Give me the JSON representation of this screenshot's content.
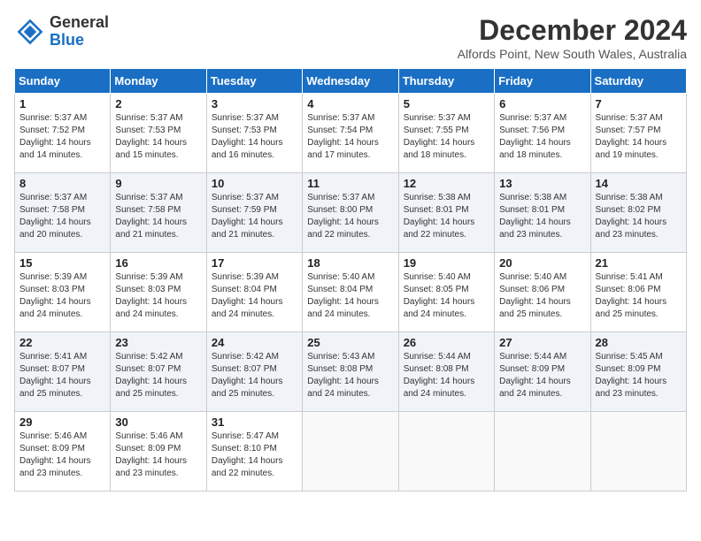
{
  "header": {
    "logo_line1": "General",
    "logo_line2": "Blue",
    "month_year": "December 2024",
    "location": "Alfords Point, New South Wales, Australia"
  },
  "weekdays": [
    "Sunday",
    "Monday",
    "Tuesday",
    "Wednesday",
    "Thursday",
    "Friday",
    "Saturday"
  ],
  "weeks": [
    [
      {
        "day": "1",
        "sunrise": "5:37 AM",
        "sunset": "7:52 PM",
        "daylight": "14 hours and 14 minutes."
      },
      {
        "day": "2",
        "sunrise": "5:37 AM",
        "sunset": "7:53 PM",
        "daylight": "14 hours and 15 minutes."
      },
      {
        "day": "3",
        "sunrise": "5:37 AM",
        "sunset": "7:53 PM",
        "daylight": "14 hours and 16 minutes."
      },
      {
        "day": "4",
        "sunrise": "5:37 AM",
        "sunset": "7:54 PM",
        "daylight": "14 hours and 17 minutes."
      },
      {
        "day": "5",
        "sunrise": "5:37 AM",
        "sunset": "7:55 PM",
        "daylight": "14 hours and 18 minutes."
      },
      {
        "day": "6",
        "sunrise": "5:37 AM",
        "sunset": "7:56 PM",
        "daylight": "14 hours and 18 minutes."
      },
      {
        "day": "7",
        "sunrise": "5:37 AM",
        "sunset": "7:57 PM",
        "daylight": "14 hours and 19 minutes."
      }
    ],
    [
      {
        "day": "8",
        "sunrise": "5:37 AM",
        "sunset": "7:58 PM",
        "daylight": "14 hours and 20 minutes."
      },
      {
        "day": "9",
        "sunrise": "5:37 AM",
        "sunset": "7:58 PM",
        "daylight": "14 hours and 21 minutes."
      },
      {
        "day": "10",
        "sunrise": "5:37 AM",
        "sunset": "7:59 PM",
        "daylight": "14 hours and 21 minutes."
      },
      {
        "day": "11",
        "sunrise": "5:37 AM",
        "sunset": "8:00 PM",
        "daylight": "14 hours and 22 minutes."
      },
      {
        "day": "12",
        "sunrise": "5:38 AM",
        "sunset": "8:01 PM",
        "daylight": "14 hours and 22 minutes."
      },
      {
        "day": "13",
        "sunrise": "5:38 AM",
        "sunset": "8:01 PM",
        "daylight": "14 hours and 23 minutes."
      },
      {
        "day": "14",
        "sunrise": "5:38 AM",
        "sunset": "8:02 PM",
        "daylight": "14 hours and 23 minutes."
      }
    ],
    [
      {
        "day": "15",
        "sunrise": "5:39 AM",
        "sunset": "8:03 PM",
        "daylight": "14 hours and 24 minutes."
      },
      {
        "day": "16",
        "sunrise": "5:39 AM",
        "sunset": "8:03 PM",
        "daylight": "14 hours and 24 minutes."
      },
      {
        "day": "17",
        "sunrise": "5:39 AM",
        "sunset": "8:04 PM",
        "daylight": "14 hours and 24 minutes."
      },
      {
        "day": "18",
        "sunrise": "5:40 AM",
        "sunset": "8:04 PM",
        "daylight": "14 hours and 24 minutes."
      },
      {
        "day": "19",
        "sunrise": "5:40 AM",
        "sunset": "8:05 PM",
        "daylight": "14 hours and 24 minutes."
      },
      {
        "day": "20",
        "sunrise": "5:40 AM",
        "sunset": "8:06 PM",
        "daylight": "14 hours and 25 minutes."
      },
      {
        "day": "21",
        "sunrise": "5:41 AM",
        "sunset": "8:06 PM",
        "daylight": "14 hours and 25 minutes."
      }
    ],
    [
      {
        "day": "22",
        "sunrise": "5:41 AM",
        "sunset": "8:07 PM",
        "daylight": "14 hours and 25 minutes."
      },
      {
        "day": "23",
        "sunrise": "5:42 AM",
        "sunset": "8:07 PM",
        "daylight": "14 hours and 25 minutes."
      },
      {
        "day": "24",
        "sunrise": "5:42 AM",
        "sunset": "8:07 PM",
        "daylight": "14 hours and 25 minutes."
      },
      {
        "day": "25",
        "sunrise": "5:43 AM",
        "sunset": "8:08 PM",
        "daylight": "14 hours and 24 minutes."
      },
      {
        "day": "26",
        "sunrise": "5:44 AM",
        "sunset": "8:08 PM",
        "daylight": "14 hours and 24 minutes."
      },
      {
        "day": "27",
        "sunrise": "5:44 AM",
        "sunset": "8:09 PM",
        "daylight": "14 hours and 24 minutes."
      },
      {
        "day": "28",
        "sunrise": "5:45 AM",
        "sunset": "8:09 PM",
        "daylight": "14 hours and 23 minutes."
      }
    ],
    [
      {
        "day": "29",
        "sunrise": "5:46 AM",
        "sunset": "8:09 PM",
        "daylight": "14 hours and 23 minutes."
      },
      {
        "day": "30",
        "sunrise": "5:46 AM",
        "sunset": "8:09 PM",
        "daylight": "14 hours and 23 minutes."
      },
      {
        "day": "31",
        "sunrise": "5:47 AM",
        "sunset": "8:10 PM",
        "daylight": "14 hours and 22 minutes."
      },
      null,
      null,
      null,
      null
    ]
  ]
}
